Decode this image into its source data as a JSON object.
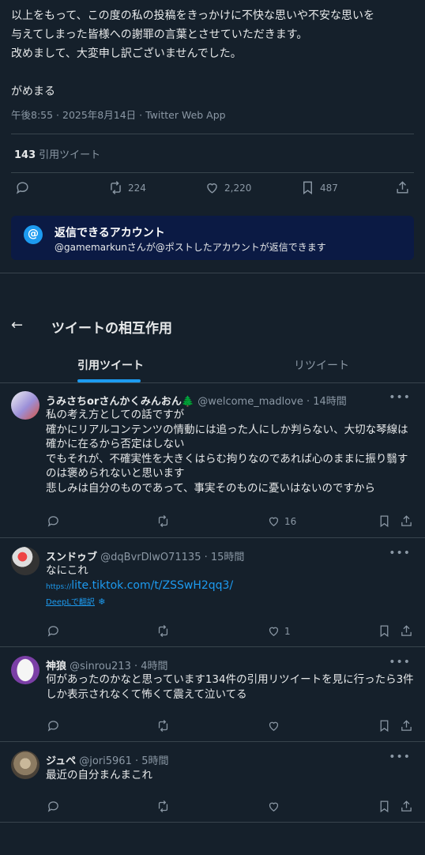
{
  "tweet": {
    "lines": [
      "以上をもって、この度の私の投稿をきっかけに不快な思いや不安な思いを",
      "与えてしまった皆様への謝罪の言葉とさせていただきます。",
      "改めまして、大変申し訳ございませんでした。",
      "",
      "がめまる"
    ],
    "meta": "午後8:55 · 2025年8月14日 · Twitter Web App",
    "quote_count": "143",
    "quote_label": "引用ツイート",
    "retweets": "224",
    "likes": "2,220",
    "bookmarks": "487"
  },
  "reply_restriction": {
    "icon": "@",
    "title": "返信できるアカウント",
    "subtitle": "@gamemarkunさんが@ポストしたアカウントが返信できます"
  },
  "header": {
    "back": "←",
    "title": "ツイートの相互作用"
  },
  "tabs": [
    {
      "label": "引用ツイート",
      "active": true
    },
    {
      "label": "リツイート",
      "active": false
    }
  ],
  "quotes": [
    {
      "name": "うみさちorさんかくみんおん🌲",
      "handle": "@welcome_madlove · 14時間",
      "lines": [
        "私の考え方としての話ですが",
        "確かにリアルコンテンツの情動には追った人にしか判らない、大切な琴線は",
        "確かに在るから否定はしない",
        "でもそれが、不確実性を大きくはらむ拘りなのであれば心のままに振り翳す",
        "のは褒められないと思います",
        "悲しみは自分のものであって、事実そのものに憂いはないのですから"
      ],
      "likes": "16"
    },
    {
      "name": "スンドゥブ",
      "handle": "@dqBvrDlwO71135 · 15時間",
      "lines": [
        "なにこれ"
      ],
      "link_prefix": "https://",
      "link": "lite.tiktok.com/t/ZSSwH2qq3/",
      "translate": "DeepLで翻訳",
      "likes": "1"
    },
    {
      "name": "神狼",
      "handle": "@sinrou213 · 4時間",
      "lines": [
        "何があったのかなと思っています134件の引用リツイートを見に行ったら3件",
        "しか表示されなくて怖くて震えて泣いてる"
      ],
      "likes": ""
    },
    {
      "name": "ジュペ",
      "handle": "@jori5961 · 5時間",
      "lines": [
        "最近の自分まんまこれ"
      ],
      "likes": ""
    }
  ],
  "colors": {
    "background": "#15202b",
    "accent": "#1d9bf0",
    "muted": "#8b98a5",
    "divider": "#38444d"
  }
}
